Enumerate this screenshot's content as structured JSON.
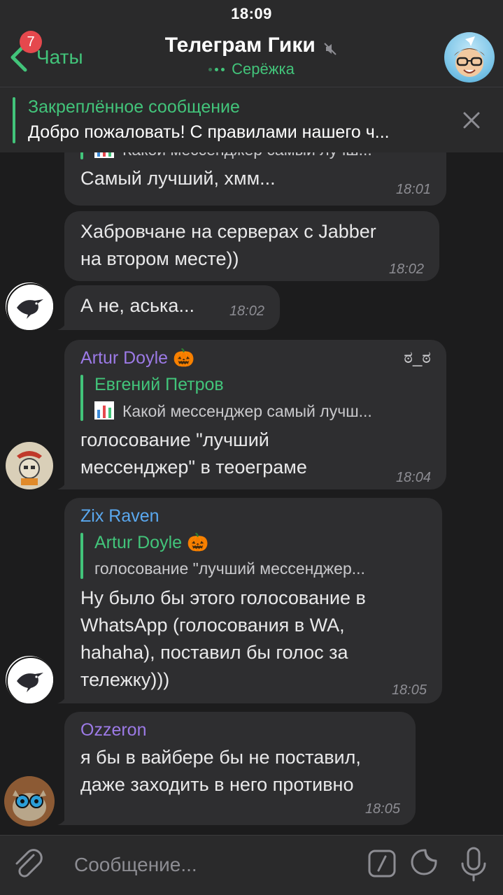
{
  "status_bar": {
    "time": "18:09"
  },
  "header": {
    "back_label": "Чаты",
    "unread_badge": "7",
    "title": "Телеграм Гики",
    "subtitle": "Серёжка",
    "muted": true
  },
  "pinned": {
    "title": "Закреплённое сообщение",
    "text": "Добро пожаловать! С правилами нашего ч..."
  },
  "messages": [
    {
      "reply_preview": "Какой мессенджер самый лучш...",
      "text_lines": [
        "Самый лучший, хмм..."
      ],
      "time": "18:01"
    },
    {
      "text_lines": [
        "Хабровчане на серверах с Jabber",
        "на втором месте))"
      ],
      "time": "18:02"
    },
    {
      "text_lines": [
        "А не, аська..."
      ],
      "time": "18:02"
    },
    {
      "author": "Artur Doyle 🎃",
      "author_suffix": "ಠ_ಠ",
      "author_color": "#9c7ae6",
      "reply": {
        "author": "Евгений Петров",
        "text": "Какой мессенджер самый лучш..."
      },
      "text_lines": [
        "голосование \"лучший",
        "мессенджер\" в теоеграме"
      ],
      "time": "18:04"
    },
    {
      "author": "Zix Raven",
      "author_color": "#5aa8ef",
      "reply": {
        "author": "Artur Doyle 🎃",
        "text": "голосование \"лучший мессенджер..."
      },
      "text_lines": [
        "Ну было бы этого голосование в",
        "WhatsApp (голосования в WA,",
        "hahaha), поставил бы голос за",
        "тележку)))"
      ],
      "time": "18:05"
    },
    {
      "author": "Ozzeron",
      "author_color": "#9c7ae6",
      "text_lines": [
        "я бы в вайбере бы не поставил,",
        "даже заходить в него противно"
      ],
      "time": "18:05"
    }
  ],
  "input": {
    "placeholder": "Сообщение..."
  },
  "colors": {
    "accent": "#42c47a",
    "bubble": "#2e2e30",
    "background": "#1c1c1d",
    "badge": "#e5484d"
  }
}
